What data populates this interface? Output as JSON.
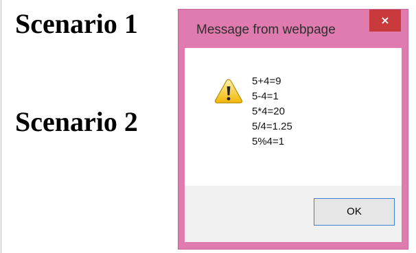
{
  "page": {
    "headings": [
      "Scenario 1",
      "Scenario 2"
    ]
  },
  "dialog": {
    "title": "Message from webpage",
    "close_glyph": "×",
    "icon": "warning-icon",
    "message_lines": [
      "5+4=9",
      "5-4=1",
      "5*4=20",
      "5/4=1.25",
      "5%4=1"
    ],
    "ok_label": "OK",
    "colors": {
      "frame": "#e07bb0",
      "close_button": "#c7393a",
      "button_area": "#f0f0f0",
      "ok_border": "#3c7fd3"
    }
  }
}
